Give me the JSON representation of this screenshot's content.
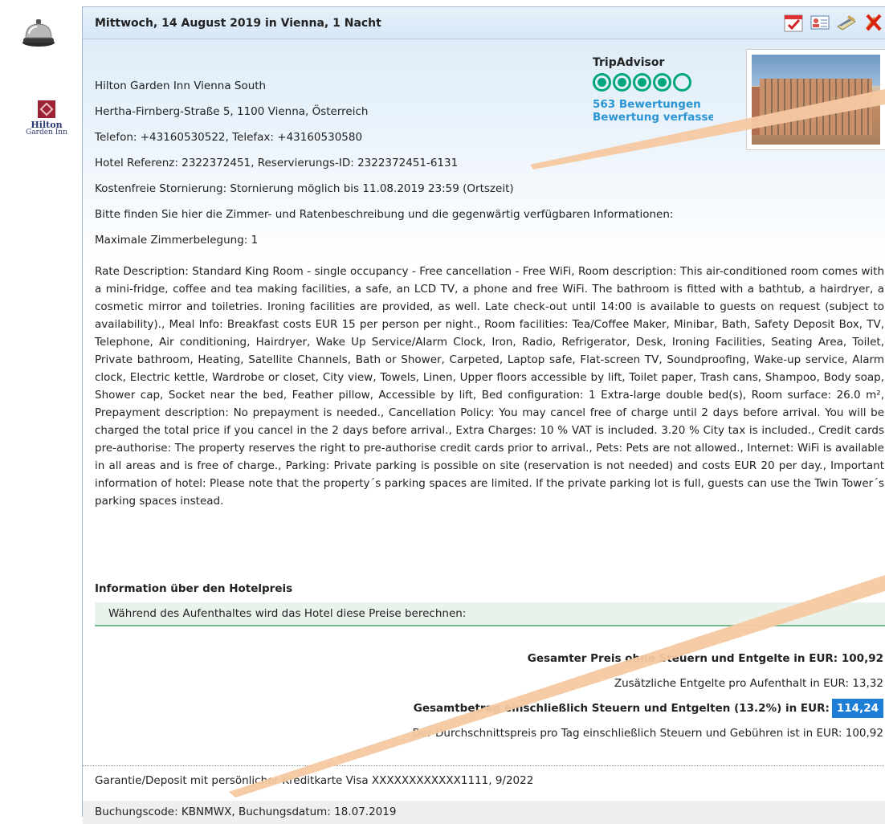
{
  "header": {
    "title": "Mittwoch, 14 August 2019 in Vienna, 1 Nacht",
    "toolbar_icons": [
      "calendar-check-icon",
      "contact-card-icon",
      "pen-edit-icon",
      "cancel-icon"
    ]
  },
  "hotel": {
    "name": "Hilton Garden Inn Vienna South",
    "address": "Hertha-Firnberg-Straße 5, 1100 Vienna, Österreich",
    "phone": "Telefon: +43160530522, Telefax: +43160530580",
    "reference": "Hotel Referenz: 2322372451, Reservierungs-ID: 2322372451-6131",
    "cancellation": "Kostenfreie Stornierung: Stornierung möglich bis 11.08.2019 23:59 (Ortszeit)",
    "info_intro": "Bitte finden Sie hier die Zimmer- und Ratenbeschreibung und die gegenwärtig verfügbaren Informationen:",
    "max_occupancy": "Maximale Zimmerbelegung: 1",
    "logo": {
      "name": "Hilton",
      "sub": "Garden Inn"
    }
  },
  "tripadvisor": {
    "title": "TripAdvisor",
    "rating_fraction": 0.8,
    "reviews": "563 Bewertungen",
    "rating_link": "Bewertung verfassen"
  },
  "description": "Rate Description: Standard King Room - single occupancy - Free cancellation - Free WiFi, Room description: This air-conditioned room comes with a mini-fridge, coffee and tea making facilities, a safe, an LCD TV, a phone and free WiFi. The bathroom is fitted with a bathtub, a hairdryer, a cosmetic mirror and toiletries. Ironing facilities are provided, as well. Late check-out until 14:00 is available to guests on request (subject to availability)., Meal Info: Breakfast costs EUR 15 per person per night., Room facilities: Tea/Coffee Maker, Minibar, Bath, Safety Deposit Box, TV, Telephone, Air conditioning, Hairdryer, Wake Up Service/Alarm Clock, Iron, Radio, Refrigerator, Desk, Ironing Facilities, Seating Area, Toilet, Private bathroom, Heating, Satellite Channels, Bath or Shower, Carpeted, Laptop safe, Flat-screen TV, Soundproofing, Wake-up service, Alarm clock, Electric kettle, Wardrobe or closet, City view, Towels, Linen, Upper floors accessible by lift, Toilet paper, Trash cans, Shampoo, Body soap, Shower cap, Socket near the bed, Feather pillow, Accessible by lift, Bed configuration: 1 Extra-large double bed(s), Room surface: 26.0 m², Prepayment description: No prepayment is needed., Cancellation Policy: You may cancel free of charge until 2 days before arrival. You will be charged the total price if you cancel in the 2 days before arrival., Extra Charges: 10 % VAT is included. 3.20 % City tax is included., Credit cards pre-authorise: The property reserves the right to pre-authorise credit cards prior to arrival., Pets: Pets are not allowed., Internet: WiFi is available in all areas and is free of charge., Parking: Private parking is possible on site (reservation is not needed) and costs EUR 20 per day., Important information of hotel: Please note that the property´s parking spaces are limited. If the private parking lot is full, guests can use the Twin Tower´s parking spaces instead.",
  "price": {
    "section_title": "Information über den Hotelpreis",
    "info_bar": "Während des Aufenthaltes wird das Hotel diese Preise berechnen:",
    "total_without_tax": "Gesamter Preis ohne Steuern und Entgelte in EUR: 100,92",
    "additional_fees": "Zusätzliche Entgelte pro Aufenthalt in EUR: 13,32",
    "total_with_tax_label": "Gesamtbetrag einschließlich Steuern und Entgelten (13.2%) in EUR:",
    "total_with_tax_value": "114,24",
    "avg_per_day": "Der Durchschnittspreis pro Tag einschließlich Steuern und Gebühren ist in EUR: 100,92"
  },
  "guarantee": "Garantie/Deposit mit persönlicher Kreditkarte Visa XXXXXXXXXXXX1111, 9/2022",
  "booking": "Buchungscode: KBNMWX, Buchungsdatum: 18.07.2019",
  "colors": {
    "accent_blue": "#1e7ed6",
    "tripadvisor_green": "#00a680",
    "link_blue": "#2b95d3",
    "annotation_line": "#f5c9a2"
  }
}
